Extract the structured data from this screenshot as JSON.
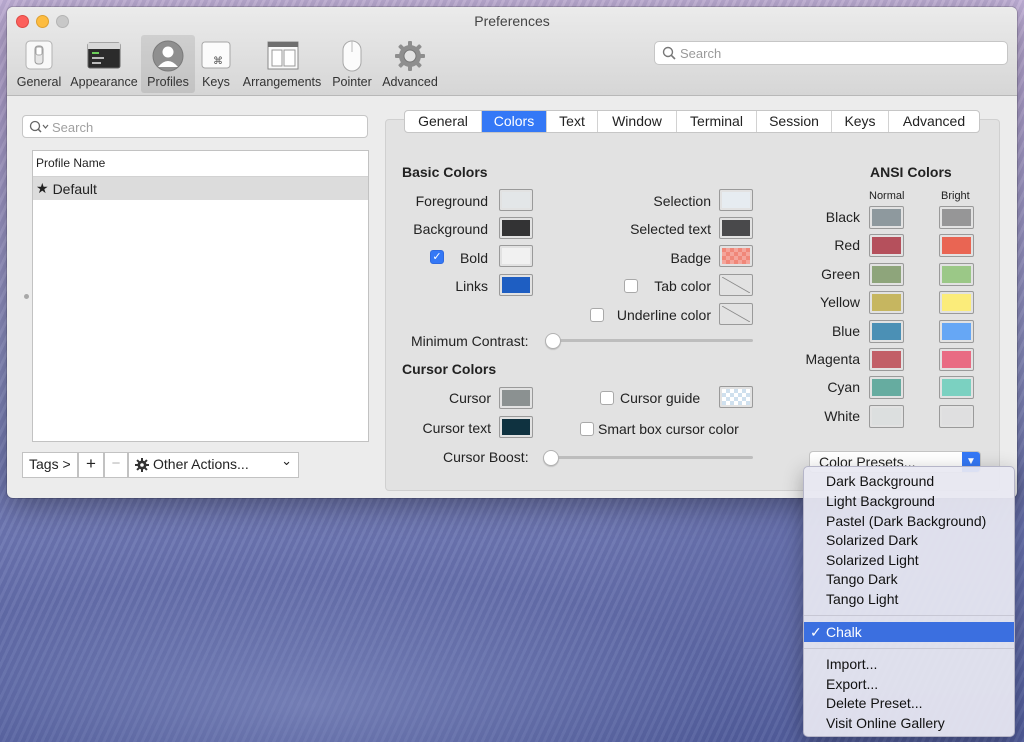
{
  "window": {
    "title": "Preferences"
  },
  "toolbar": {
    "items": [
      {
        "label": "General",
        "icon": "switch-icon"
      },
      {
        "label": "Appearance",
        "icon": "terminal-window-icon"
      },
      {
        "label": "Profiles",
        "icon": "user-silhouette-icon"
      },
      {
        "label": "Keys",
        "icon": "command-key-icon"
      },
      {
        "label": "Arrangements",
        "icon": "window-layout-icon"
      },
      {
        "label": "Pointer",
        "icon": "mouse-icon"
      },
      {
        "label": "Advanced",
        "icon": "gear-icon"
      }
    ],
    "active": "Profiles",
    "search_placeholder": "Search"
  },
  "profiles": {
    "search_placeholder": "Search",
    "column_header": "Profile Name",
    "rows": [
      {
        "name": "Default",
        "default_marker": "★"
      }
    ],
    "tags_label": "Tags >",
    "add_symbol": "+",
    "remove_symbol": "−",
    "other_actions_label": "Other Actions...",
    "other_actions_arrow": "⌄"
  },
  "tabs": {
    "items": [
      "General",
      "Colors",
      "Text",
      "Window",
      "Terminal",
      "Session",
      "Keys",
      "Advanced"
    ],
    "active": "Colors"
  },
  "basic_colors": {
    "title": "Basic Colors",
    "foreground": {
      "label": "Foreground",
      "color": "#e3e6e8"
    },
    "background": {
      "label": "Background",
      "color": "#333334"
    },
    "bold": {
      "label": "Bold",
      "checked": true,
      "color": "#f1f1f1"
    },
    "links": {
      "label": "Links",
      "color": "#1e5ec2"
    },
    "selection": {
      "label": "Selection",
      "color": "#e6ecf1"
    },
    "selected_text": {
      "label": "Selected text",
      "color": "#49494b"
    },
    "badge": {
      "label": "Badge",
      "color": "#f08779"
    },
    "tab_color": {
      "label": "Tab color",
      "checked": false
    },
    "underline_color": {
      "label": "Underline color",
      "checked": false
    },
    "minimum_contrast": {
      "label": "Minimum Contrast:",
      "value": 0
    }
  },
  "cursor_colors": {
    "title": "Cursor Colors",
    "cursor": {
      "label": "Cursor",
      "color": "#8b9191"
    },
    "cursor_text": {
      "label": "Cursor text",
      "color": "#0f3240"
    },
    "cursor_guide": {
      "label": "Cursor guide",
      "checked": false
    },
    "smart_box": {
      "label": "Smart box cursor color",
      "checked": false
    },
    "cursor_boost": {
      "label": "Cursor Boost:",
      "value": 0
    }
  },
  "ansi": {
    "title": "ANSI Colors",
    "normal_header": "Normal",
    "bright_header": "Bright",
    "rows": [
      {
        "name": "Black",
        "normal": "#8e999e",
        "bright": "#969697"
      },
      {
        "name": "Red",
        "normal": "#b5505c",
        "bright": "#e96553"
      },
      {
        "name": "Green",
        "normal": "#8ea57b",
        "bright": "#9bc887"
      },
      {
        "name": "Yellow",
        "normal": "#c6b660",
        "bright": "#fbec7a"
      },
      {
        "name": "Blue",
        "normal": "#4b90b5",
        "bright": "#66a7f5"
      },
      {
        "name": "Magenta",
        "normal": "#c25f67",
        "bright": "#e96b83"
      },
      {
        "name": "Cyan",
        "normal": "#66aca0",
        "bright": "#7bd1c1"
      },
      {
        "name": "White",
        "normal": "#dcdfdf",
        "bright": "#dfdfe0"
      }
    ]
  },
  "presets": {
    "button_label": "Color Presets...",
    "builtin": [
      "Dark Background",
      "Light Background",
      "Pastel (Dark Background)",
      "Solarized Dark",
      "Solarized Light",
      "Tango Dark",
      "Tango Light"
    ],
    "custom": [
      "Chalk"
    ],
    "selected": "Chalk",
    "check_mark": "✓",
    "actions": [
      "Import...",
      "Export...",
      "Delete Preset...",
      "Visit Online Gallery"
    ]
  }
}
